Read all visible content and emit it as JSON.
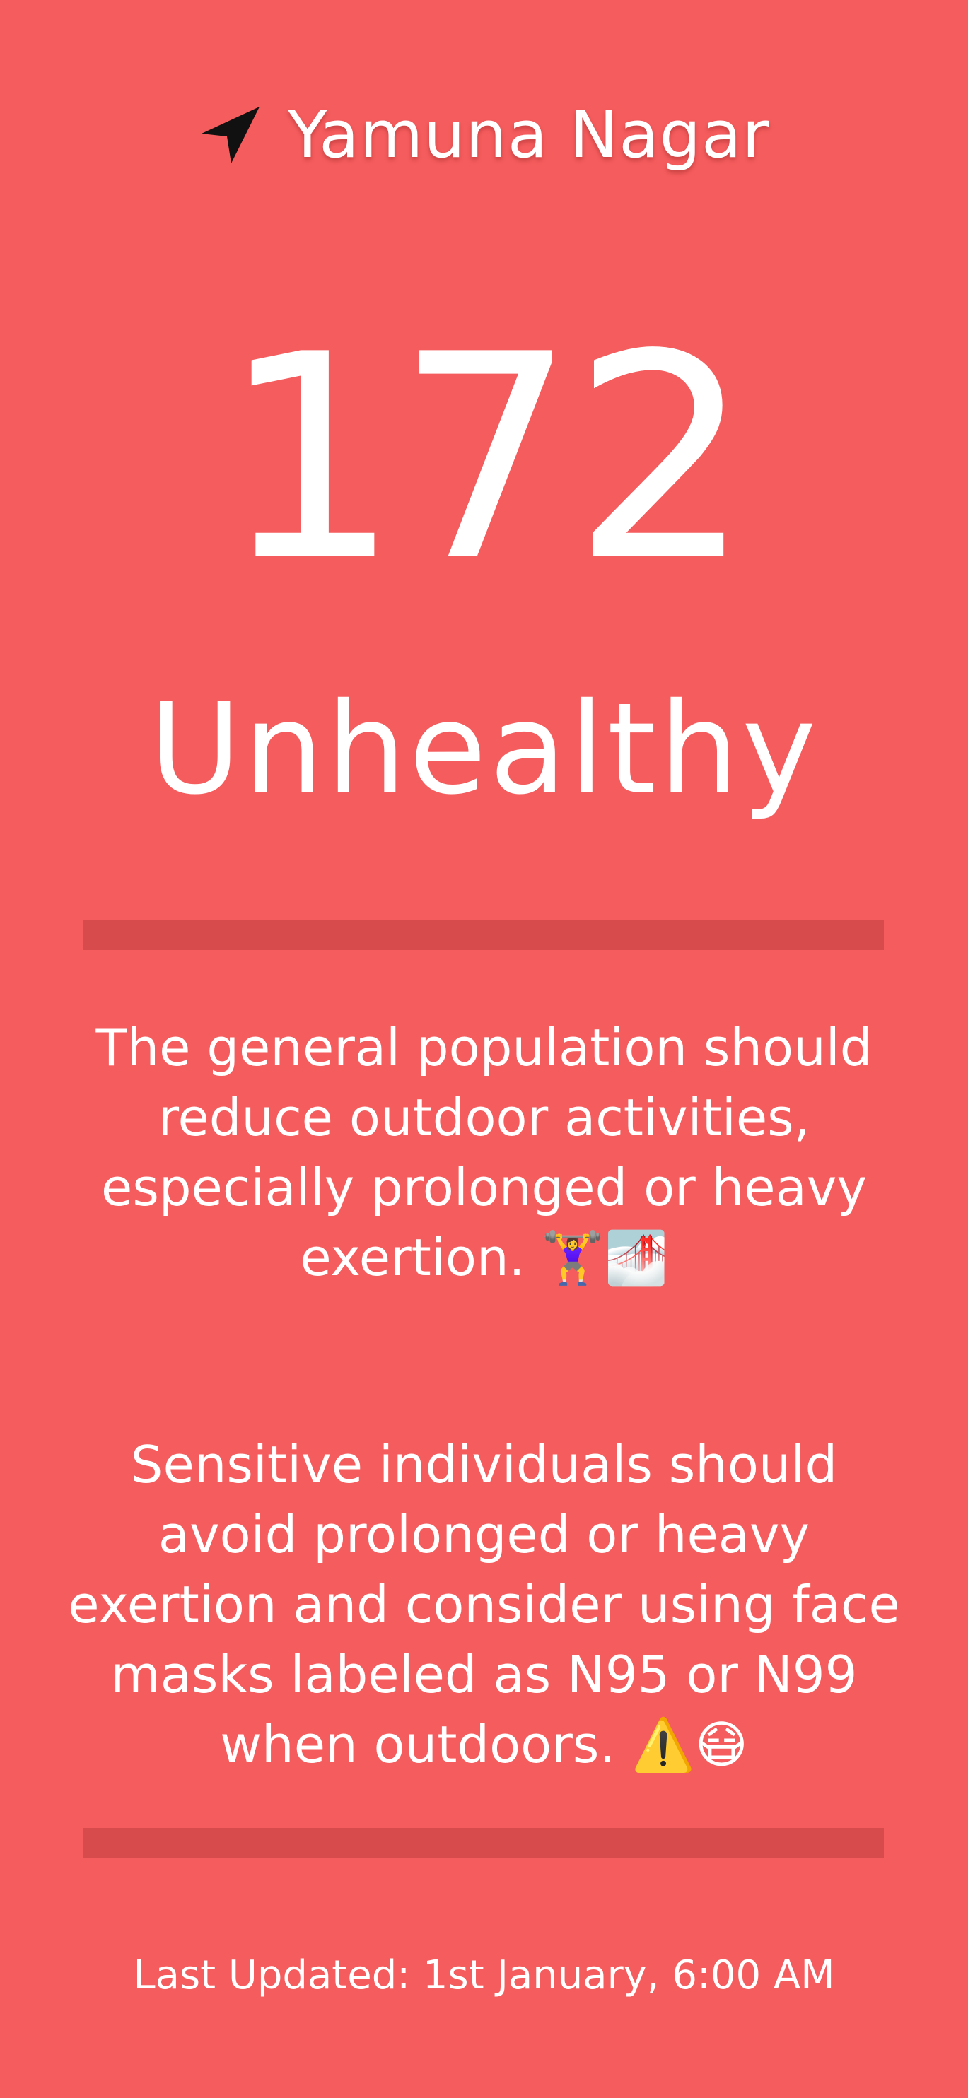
{
  "location": {
    "icon": "navigation-arrow-icon",
    "name": "Yamuna Nagar"
  },
  "aqi": {
    "value": "172",
    "category": "Unhealthy"
  },
  "advice": {
    "general": "The general population should reduce outdoor activities, especially prolonged or heavy exertion. 🏋️‍♀️🌁",
    "sensitive": "Sensitive individuals should avoid prolonged or heavy exertion and consider using face masks labeled as N95 or N99 when outdoors. ⚠️😷"
  },
  "footer": {
    "last_updated": "Last Updated: 1st January, 6:00 AM"
  },
  "colors": {
    "background": "#f55c5d",
    "divider": "#d84b4d",
    "text": "#ffffff",
    "icon": "#111111"
  }
}
